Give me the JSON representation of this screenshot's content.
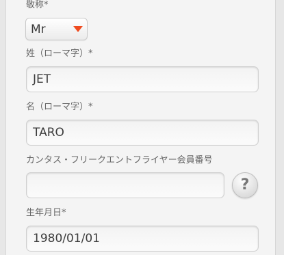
{
  "form": {
    "title": {
      "label": "敬称*",
      "selected": "Mr"
    },
    "last_name": {
      "label": "姓（ローマ字）*",
      "value": "JET"
    },
    "first_name": {
      "label": "名（ローマ字）*",
      "value": "TARO"
    },
    "qantas_number": {
      "label": "カンタス・フリークエントフライヤー会員番号",
      "value": "",
      "help_glyph": "?"
    },
    "birth_date": {
      "label": "生年月日*",
      "value": "1980/01/01"
    }
  },
  "colors": {
    "arrow_accent": "#ef4b1f"
  },
  "icons": {
    "dropdown": "chevron-down-icon",
    "help": "question-mark-icon"
  }
}
